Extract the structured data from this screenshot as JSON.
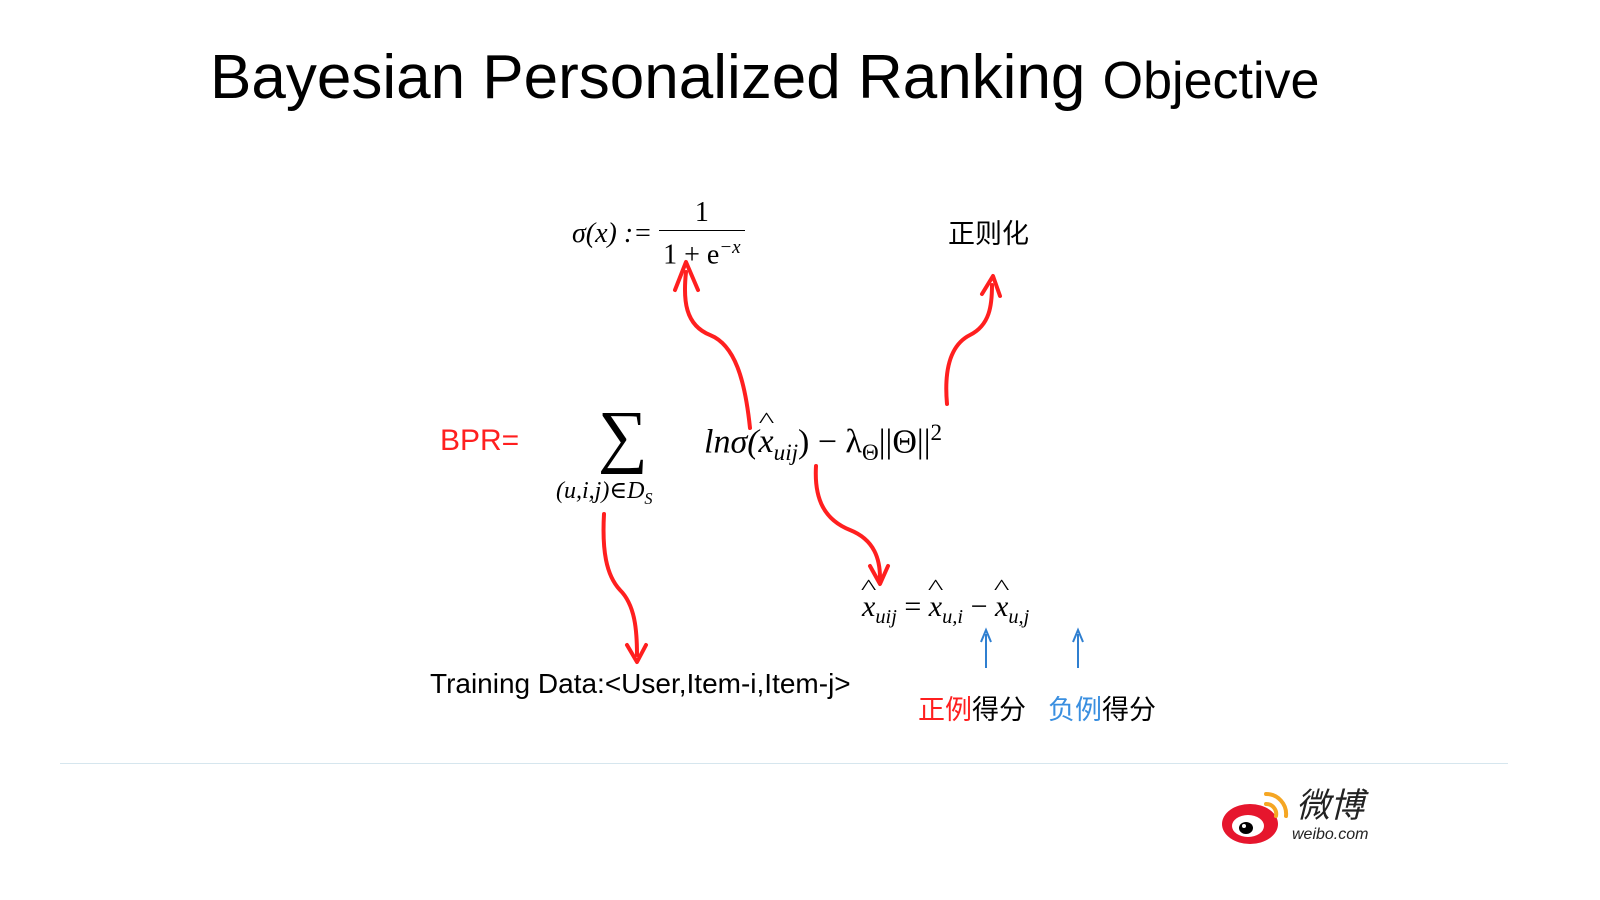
{
  "title": {
    "main": "Bayesian Personalized Ranking",
    "sub": "Objective"
  },
  "sigmoid": {
    "lhs": "σ(x) :=",
    "numerator": "1",
    "denominator_base": "1 + e",
    "denominator_exp": "−x"
  },
  "regularization_label": "正则化",
  "bpr": {
    "label": "BPR=",
    "sum_symbol": "∑",
    "sum_subscript": "(u,i,j)∈D",
    "sum_subscript_sub": "S",
    "ln_sigma": "lnσ(",
    "x": "x",
    "x_sub": "uij",
    "close_minus": ") − λ",
    "lambda_sub": "Θ",
    "norm": "||Θ||",
    "norm_sup": "2"
  },
  "xuij": {
    "x": "x",
    "sub": "uij",
    "eq": " = ",
    "x_ui_sub": "u,i",
    "minus": " − ",
    "x_uj_sub": "u,j"
  },
  "training_data": "Training Data:<User,Item-i,Item-j>",
  "positive_score": {
    "colored": "正例",
    "rest": "得分"
  },
  "negative_score": {
    "colored": "负例",
    "rest": "得分"
  },
  "logo": {
    "cn": "微博",
    "url": "weibo.com"
  },
  "colors": {
    "arrow_red": "#ff1f1f",
    "arrow_blue": "#2f7fd0",
    "rule": "#d6e6ee",
    "logo_red": "#e6162d",
    "logo_orange": "#f5a623"
  }
}
